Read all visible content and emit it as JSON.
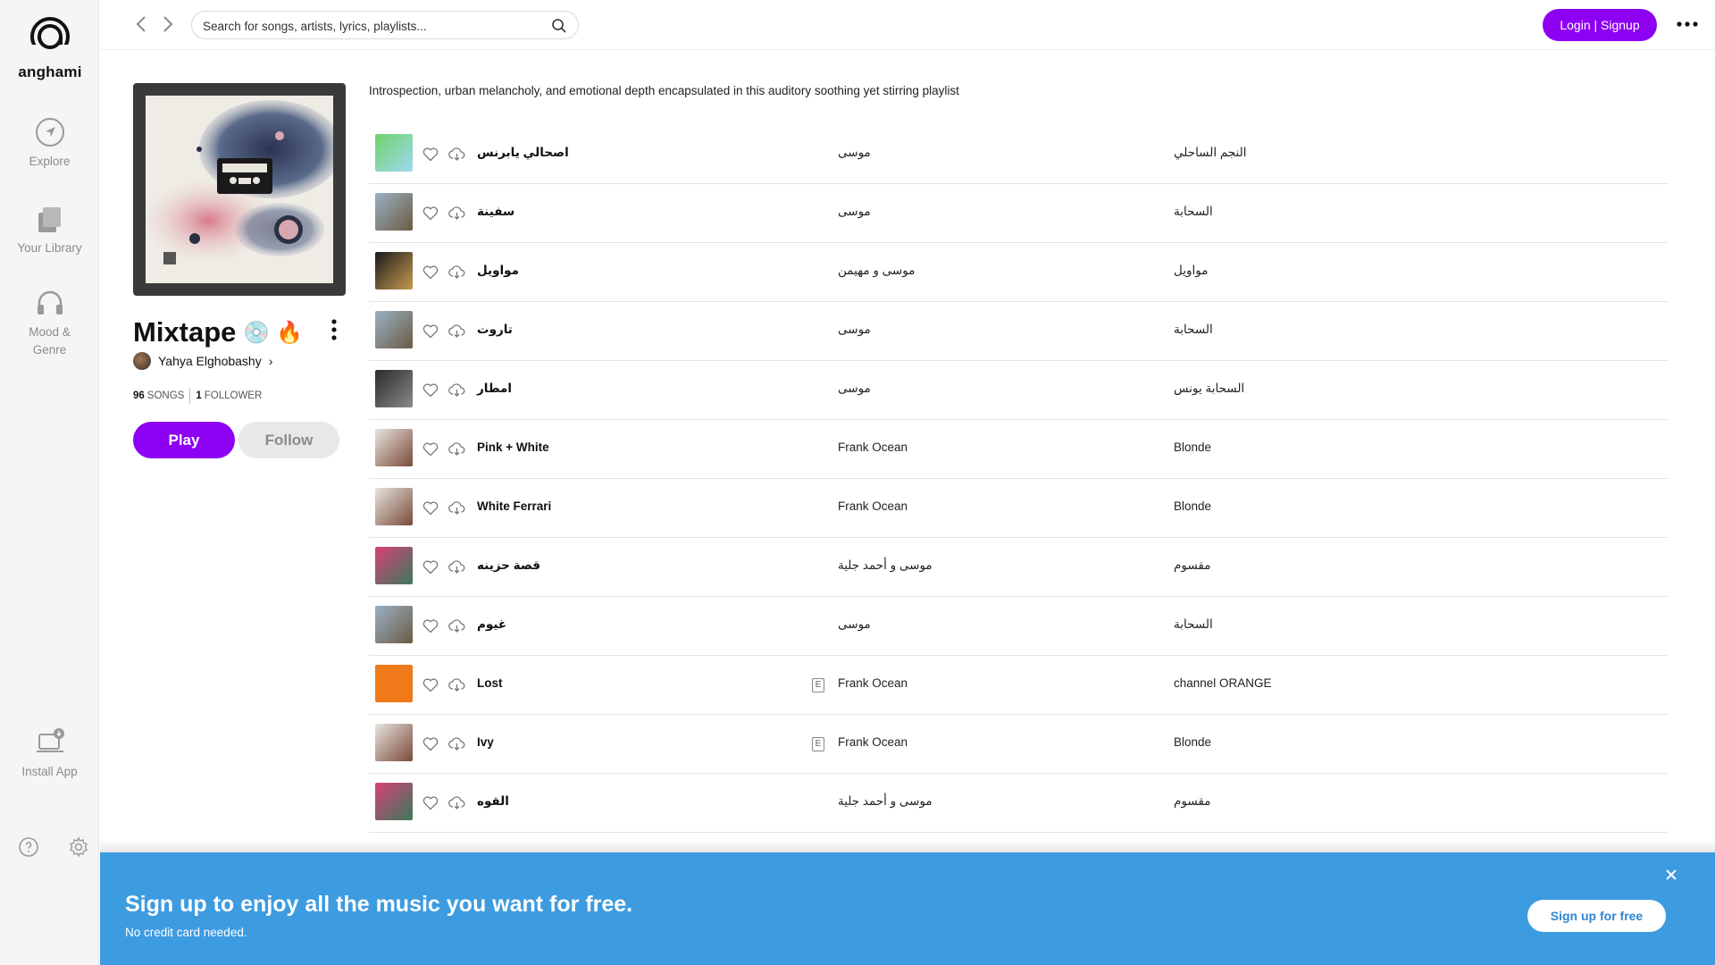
{
  "sidebar": {
    "logo_text": "anghami",
    "items": [
      {
        "label": "Explore",
        "icon": "explore-icon"
      },
      {
        "label": "Your Library",
        "icon": "library-icon"
      },
      {
        "label": "Mood &",
        "label2": "Genre",
        "icon": "headphones-icon"
      },
      {
        "label": "Install App",
        "icon": "laptop-download-icon"
      }
    ]
  },
  "topbar": {
    "search_placeholder": "Search for songs, artists, lyrics, playlists...",
    "login_label": "Login | Signup"
  },
  "playlist": {
    "title": "Mixtape",
    "emoji": "💿 🔥",
    "owner": "Yahya Elghobashy",
    "owner_chevron": "›",
    "songs_count": "96",
    "songs_label": "SONGS",
    "followers_count": "1",
    "followers_label": "FOLLOWER",
    "play_label": "Play",
    "follow_label": "Follow",
    "description": "Introspection, urban melancholy, and emotional depth encapsulated in this auditory soothing yet stirring playlist"
  },
  "tracks": [
    {
      "name": "اصحالي يابرنس",
      "artist": "موسى",
      "album": "النجم الساحلي",
      "explicit": false,
      "art": [
        "#6fd36a",
        "#9fd8f0"
      ]
    },
    {
      "name": "سفينة",
      "artist": "موسى",
      "album": "السحابة",
      "explicit": false,
      "art": [
        "#9ab0c4",
        "#6b5b44"
      ]
    },
    {
      "name": "مواويل",
      "artist": "موسى و مهيمن",
      "album": "مواويل",
      "explicit": false,
      "art": [
        "#1a1a1a",
        "#c79a50"
      ]
    },
    {
      "name": "تاروت",
      "artist": "موسى",
      "album": "السحابة",
      "explicit": false,
      "art": [
        "#9ab0c4",
        "#6b5b44"
      ]
    },
    {
      "name": "امطار",
      "artist": "موسى",
      "album": "السحابة يونس",
      "explicit": false,
      "art": [
        "#2a2a2a",
        "#8a8a8a"
      ]
    },
    {
      "name": "Pink + White",
      "artist": "Frank Ocean",
      "album": "Blonde",
      "explicit": false,
      "art": [
        "#e8e4de",
        "#7a4a3a"
      ]
    },
    {
      "name": "White Ferrari",
      "artist": "Frank Ocean",
      "album": "Blonde",
      "explicit": false,
      "art": [
        "#e8e4de",
        "#7a4a3a"
      ]
    },
    {
      "name": "قصة حزينه",
      "artist": "موسى و أحمد جلية",
      "album": "مقسوم",
      "explicit": false,
      "art": [
        "#d8407a",
        "#3a7a5a"
      ]
    },
    {
      "name": "غيوم",
      "artist": "موسى",
      "album": "السحابة",
      "explicit": false,
      "art": [
        "#9ab0c4",
        "#6b5b44"
      ]
    },
    {
      "name": "Lost",
      "artist": "Frank Ocean",
      "album": "channel ORANGE",
      "explicit": true,
      "art": [
        "#f07a1a",
        "#f07a1a"
      ]
    },
    {
      "name": "Ivy",
      "artist": "Frank Ocean",
      "album": "Blonde",
      "explicit": true,
      "art": [
        "#e8e4de",
        "#7a4a3a"
      ]
    },
    {
      "name": "القوه",
      "artist": "موسى و أحمد جلية",
      "album": "مقسوم",
      "explicit": false,
      "art": [
        "#d8407a",
        "#3a7a5a"
      ]
    }
  ],
  "explicit_marker": "E",
  "banner": {
    "title": "Sign up to enjoy all the music you want for free.",
    "subtitle": "No credit card needed.",
    "button_label": "Sign up for free"
  },
  "colors": {
    "brand_purple": "#8d00f2",
    "banner_blue": "#3d9be0"
  }
}
